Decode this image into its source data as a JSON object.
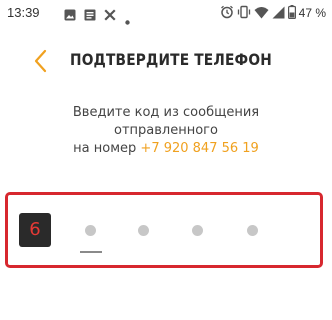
{
  "status_bar": {
    "time": "13:39",
    "battery": "47 %",
    "icons": [
      "image-icon",
      "document-icon",
      "x-icon",
      "dot-icon",
      "alarm-icon",
      "vibrate-icon",
      "wifi-icon",
      "signal-icon",
      "battery-icon"
    ]
  },
  "header": {
    "title": "ПОДТВЕРДИТЕ ТЕЛЕФОН",
    "back_icon": "chevron-left-icon"
  },
  "instruction": {
    "line1": "Введите код из сообщения",
    "line2": "отправленного",
    "line3_prefix": "на номер",
    "phone": "+7 920 847 56 19"
  },
  "code": {
    "entered_digit": "6",
    "total_positions": 5
  },
  "colors": {
    "accent": "#f0a11f",
    "highlight_border": "#d7282f",
    "digit_text": "#e53935",
    "digit_bg": "#2a2a2a",
    "dot": "#c7c7c7"
  }
}
